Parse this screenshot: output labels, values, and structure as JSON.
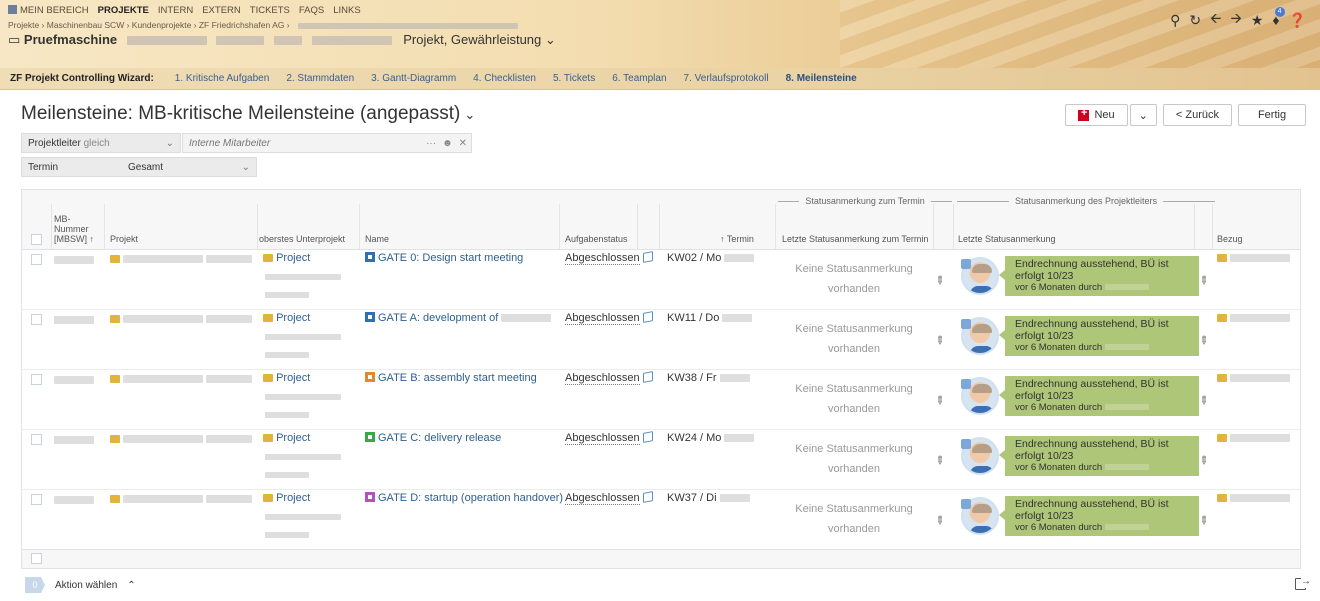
{
  "topnav": {
    "items": [
      "MEIN BEREICH",
      "PROJEKTE",
      "INTERN",
      "EXTERN",
      "TICKETS",
      "FAQS",
      "LINKS"
    ],
    "active_index": 1
  },
  "breadcrumb": "Projekte › Maschinenbau SCW › Kundenprojekte › ZF Friedrichshafen AG ›",
  "project": {
    "name": "Pruefmaschine",
    "suffix": "Projekt, Gewährleistung ⌄"
  },
  "header_icons": [
    "search-icon",
    "refresh-icon",
    "back-icon",
    "forward-icon",
    "star-icon",
    "bell-icon",
    "help-icon"
  ],
  "notifications_count": "4",
  "wizard": {
    "label": "ZF Projekt Controlling Wizard:",
    "steps": [
      "1. Kritische Aufgaben",
      "2. Stammdaten",
      "3. Gantt-Diagramm",
      "4. Checklisten",
      "5. Tickets",
      "6. Teamplan",
      "7. Verlaufsprotokoll",
      "8. Meilensteine"
    ],
    "current_index": 7
  },
  "page": {
    "title": "Meilensteine: MB-kritische Meilensteine (angepasst)",
    "buttons": {
      "new": "Neu",
      "back": "< Zurück",
      "done": "Fertig"
    }
  },
  "filters": {
    "leader_label": "Projektleiter",
    "leader_mode": "gleich",
    "leader_placeholder": "Interne Mitarbeiter",
    "termin_label": "Termin",
    "termin_mode": "Gesamt"
  },
  "table": {
    "group_headers": [
      "Statusanmerkung zum Termin",
      "Statusanmerkung des Projektleiters"
    ],
    "columns": {
      "mb_number": "MB-\nNummer\n[MBSW] ↑",
      "project": "Projekt",
      "subproject": "oberstes Unterprojekt",
      "name": "Name",
      "task_status": "Aufgabenstatus",
      "termin": "↑ Termin",
      "last_termin_note": "Letzte Statusanmerkung zum Termin",
      "last_note": "Letzte Statusanmerkung",
      "bezug": "Bezug"
    },
    "rows": [
      {
        "subproject": "Project",
        "name": "GATE 0: Design start meeting",
        "icon_color": "#2f6fb5",
        "status": "Abgeschlossen",
        "termin": "KW02 / Mo",
        "termin_note": "Keine Statusanmerkung vorhanden",
        "note": "Endrechnung ausstehend, BÜ ist erfolgt 10/23",
        "note_by": "vor 6 Monaten durch"
      },
      {
        "subproject": "Project",
        "name": "GATE A: development of",
        "icon_color": "#2f6fb5",
        "status": "Abgeschlossen",
        "termin": "KW11 / Do",
        "termin_note": "Keine Statusanmerkung vorhanden",
        "note": "Endrechnung ausstehend, BÜ ist erfolgt 10/23",
        "note_by": "vor 6 Monaten durch"
      },
      {
        "subproject": "Project",
        "name": "GATE B: assembly start meeting",
        "icon_color": "#e08a2c",
        "status": "Abgeschlossen",
        "termin": "KW38 / Fr",
        "termin_note": "Keine Statusanmerkung vorhanden",
        "note": "Endrechnung ausstehend, BÜ ist erfolgt 10/23",
        "note_by": "vor 6 Monaten durch"
      },
      {
        "subproject": "Project",
        "name": "GATE C: delivery release",
        "icon_color": "#3aa84a",
        "status": "Abgeschlossen",
        "termin": "KW24 / Mo",
        "termin_note": "Keine Statusanmerkung vorhanden",
        "note": "Endrechnung ausstehend, BÜ ist erfolgt 10/23",
        "note_by": "vor 6 Monaten durch"
      },
      {
        "subproject": "Project",
        "name": "GATE D: startup (operation handover)",
        "icon_color": "#b54fc4",
        "status": "Abgeschlossen",
        "termin": "KW37 / Di",
        "termin_note": "Keine Statusanmerkung vorhanden",
        "note": "Endrechnung ausstehend, BÜ ist erfolgt 10/23",
        "note_by": "vor 6 Monaten durch"
      }
    ]
  },
  "action_bar": {
    "count": "0",
    "label": "Aktion wählen"
  },
  "colors": {
    "accent": "#2e5f8f",
    "note_bg": "#aec678",
    "new_icon": "#d0021b"
  }
}
